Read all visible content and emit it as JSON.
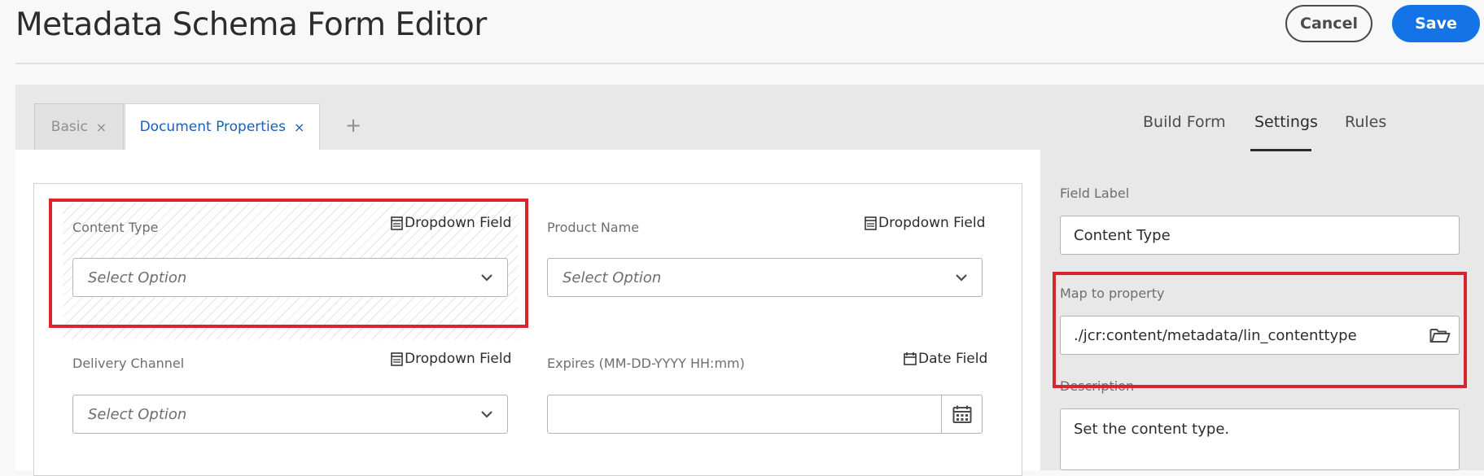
{
  "header": {
    "title": "Metadata Schema Form Editor",
    "cancel_label": "Cancel",
    "save_label": "Save"
  },
  "tabs": [
    {
      "label": "Basic",
      "close": "×",
      "active": false
    },
    {
      "label": "Document Properties",
      "close": "×",
      "active": true
    }
  ],
  "add_tab_label": "+",
  "right_tabs": [
    {
      "label": "Build Form",
      "active": false
    },
    {
      "label": "Settings",
      "active": true
    },
    {
      "label": "Rules",
      "active": false
    }
  ],
  "form_fields": [
    {
      "label": "Content Type",
      "type": "Dropdown Field",
      "placeholder": "Select Option",
      "selected": true
    },
    {
      "label": "Product Name",
      "type": "Dropdown Field",
      "placeholder": "Select Option",
      "selected": false
    },
    {
      "label": "Delivery Channel",
      "type": "Dropdown Field",
      "placeholder": "Select Option",
      "selected": false
    },
    {
      "label": "Expires (MM-DD-YYYY HH:mm)",
      "type": "Date Field",
      "value": "",
      "selected": false
    }
  ],
  "settings": {
    "field_label_title": "Field Label",
    "field_label_value": "Content Type",
    "map_title": "Map to property",
    "map_value": "./jcr:content/metadata/lin_contenttype",
    "description_title": "Description",
    "description_value": "Set the content type."
  },
  "colors": {
    "accent": "#1473e6",
    "highlight": "#d7262e",
    "active_tab_text": "#1a5fb4"
  },
  "icons": [
    "close-icon",
    "plus-icon",
    "dropdown-field-icon",
    "date-field-icon",
    "chevron-down-icon",
    "calendar-icon",
    "folder-icon"
  ]
}
